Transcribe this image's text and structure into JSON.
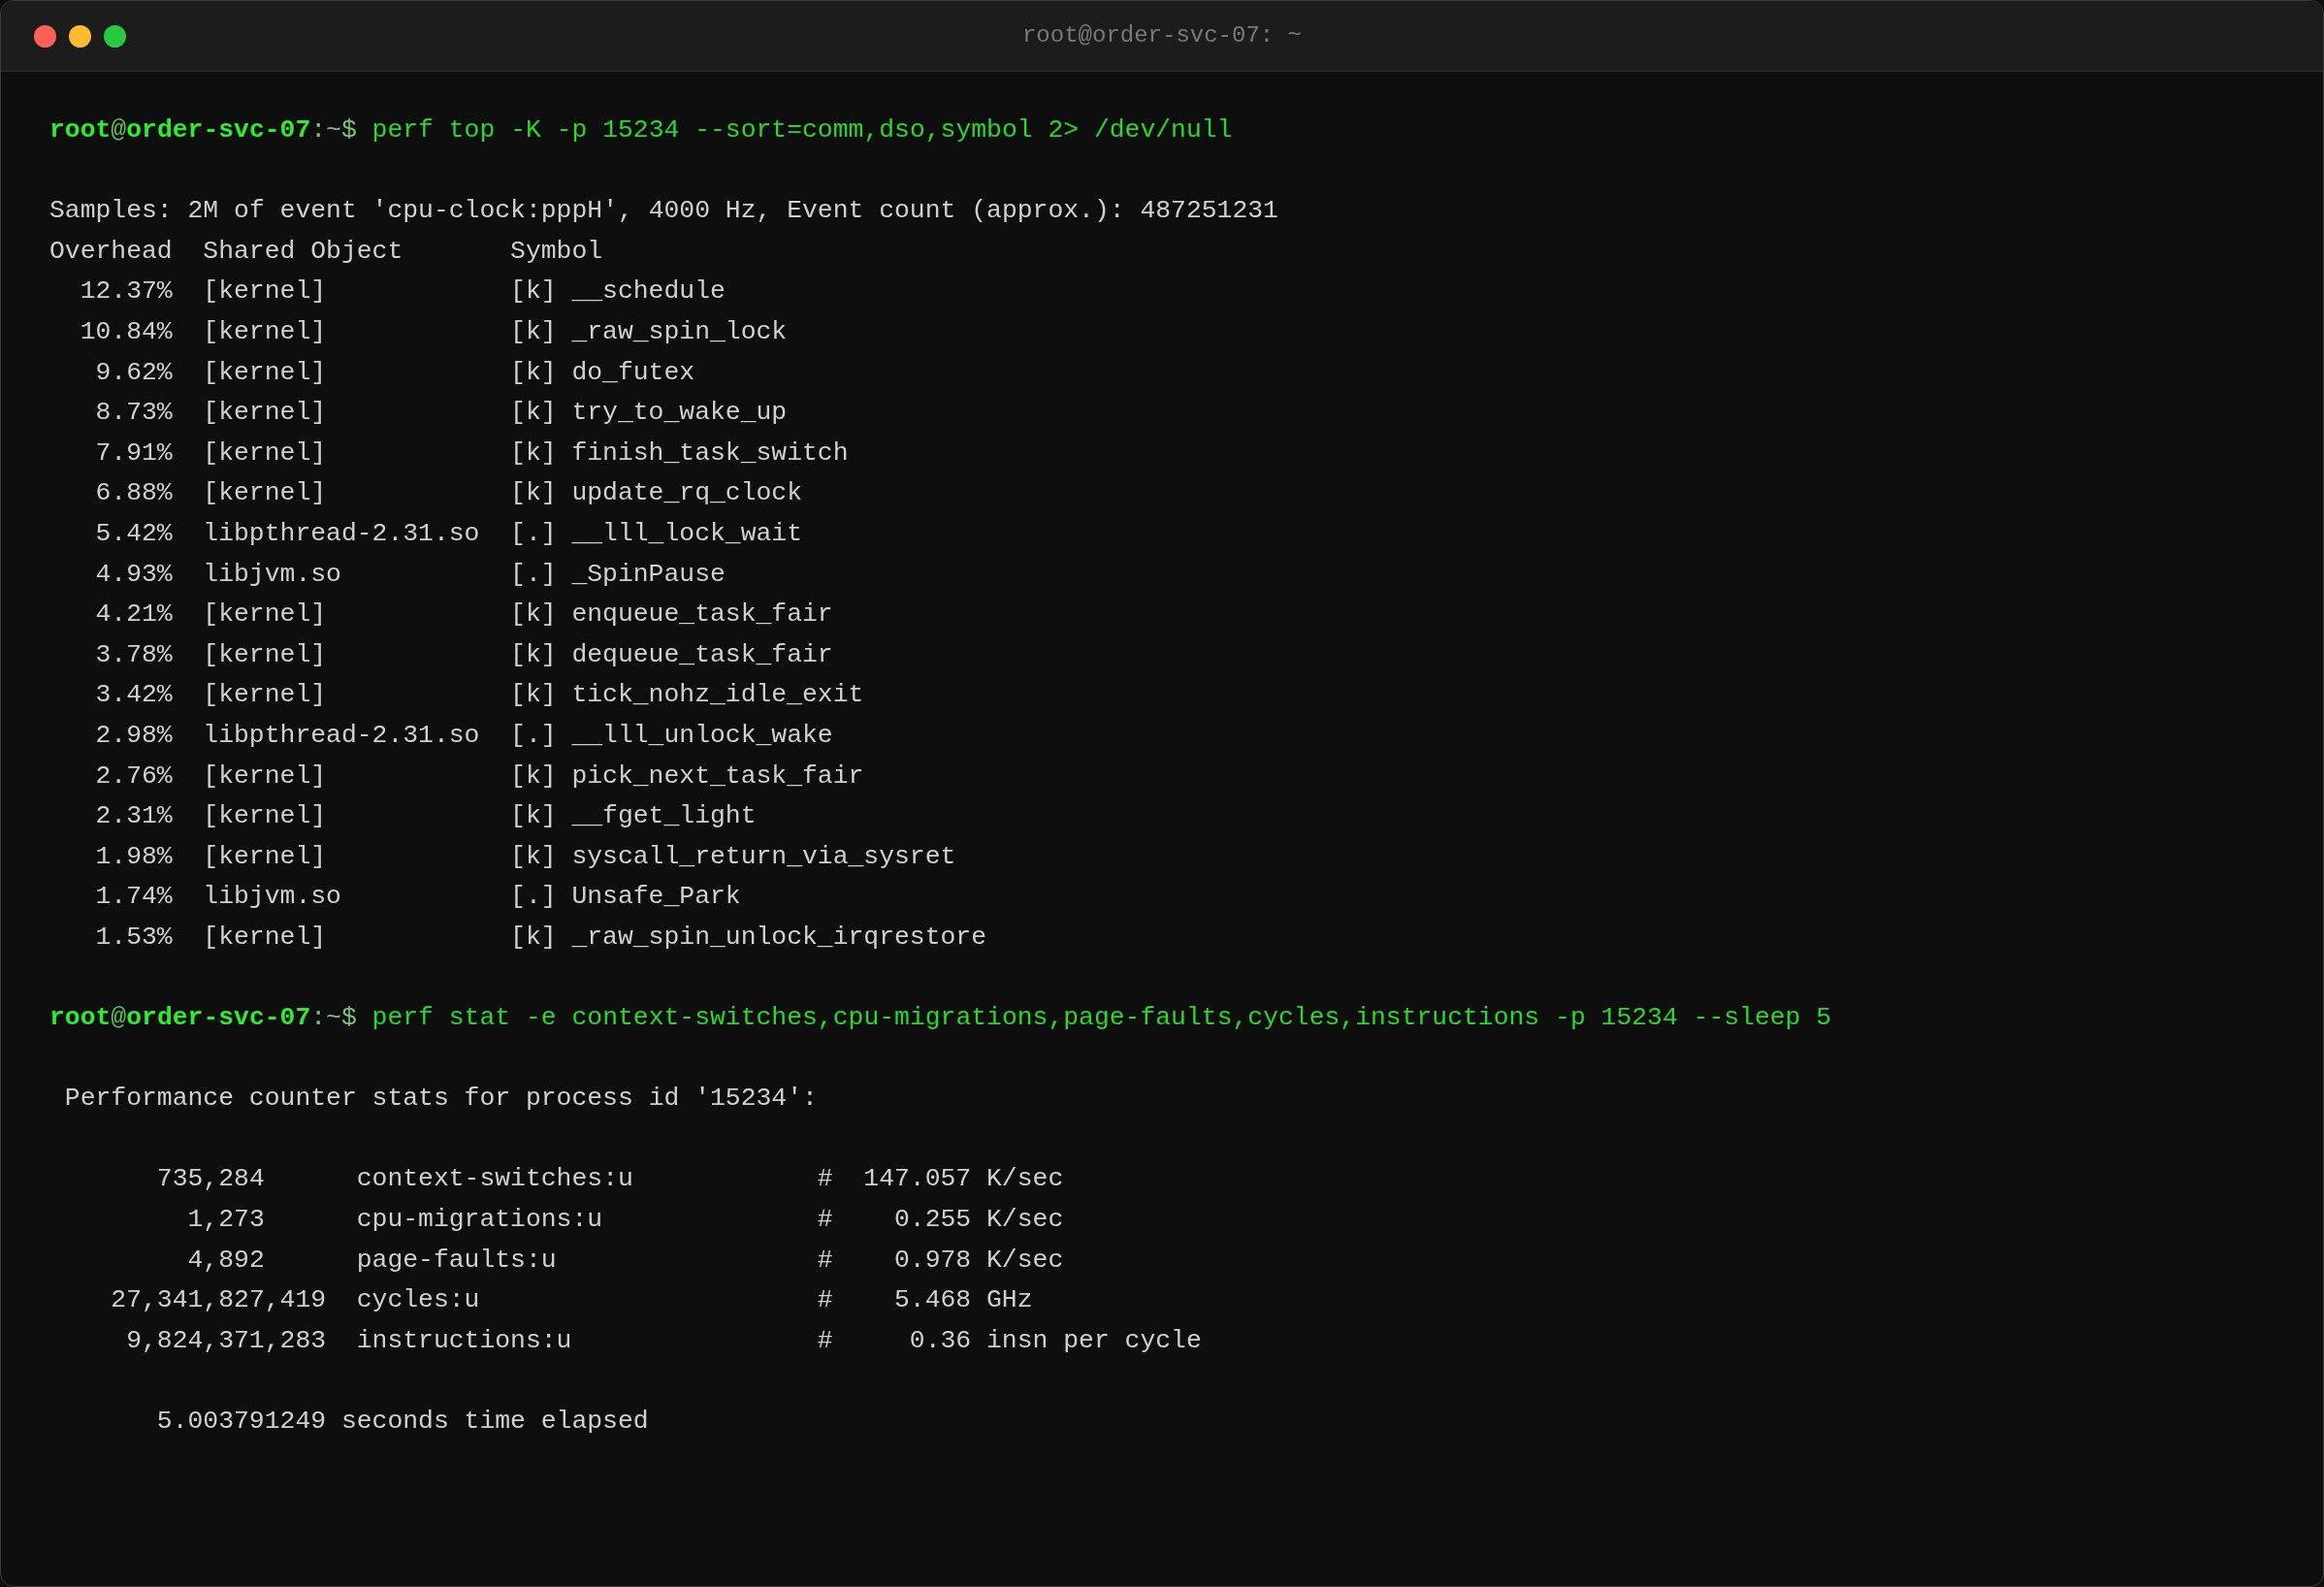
{
  "window": {
    "title": "root@order-svc-07: ~"
  },
  "lines": [
    {
      "kind": "prompt",
      "user": "root",
      "at": "@",
      "host": "order-svc-07",
      "path": ":~$",
      "command": "perf top -K -p 15234 --sort=comm,dso,symbol 2> /dev/null"
    },
    {
      "kind": "blank"
    },
    {
      "kind": "text",
      "text": "Samples: 2M of event 'cpu-clock:pppH', 4000 Hz, Event count (approx.): 487251231"
    },
    {
      "kind": "header",
      "columns": [
        "Overhead",
        "Shared Object",
        "Symbol"
      ]
    },
    {
      "kind": "perf_row",
      "overhead": "12.37%",
      "dso": "[kernel]",
      "level": "[k]",
      "symbol": "__schedule"
    },
    {
      "kind": "perf_row",
      "overhead": "10.84%",
      "dso": "[kernel]",
      "level": "[k]",
      "symbol": "_raw_spin_lock"
    },
    {
      "kind": "perf_row",
      "overhead": "9.62%",
      "dso": "[kernel]",
      "level": "[k]",
      "symbol": "do_futex"
    },
    {
      "kind": "perf_row",
      "overhead": "8.73%",
      "dso": "[kernel]",
      "level": "[k]",
      "symbol": "try_to_wake_up"
    },
    {
      "kind": "perf_row",
      "overhead": "7.91%",
      "dso": "[kernel]",
      "level": "[k]",
      "symbol": "finish_task_switch"
    },
    {
      "kind": "perf_row",
      "overhead": "6.88%",
      "dso": "[kernel]",
      "level": "[k]",
      "symbol": "update_rq_clock"
    },
    {
      "kind": "perf_row",
      "overhead": "5.42%",
      "dso": "libpthread-2.31.so",
      "level": "[.]",
      "symbol": "__lll_lock_wait"
    },
    {
      "kind": "perf_row",
      "overhead": "4.93%",
      "dso": "libjvm.so",
      "level": "[.]",
      "symbol": "_SpinPause"
    },
    {
      "kind": "perf_row",
      "overhead": "4.21%",
      "dso": "[kernel]",
      "level": "[k]",
      "symbol": "enqueue_task_fair"
    },
    {
      "kind": "perf_row",
      "overhead": "3.78%",
      "dso": "[kernel]",
      "level": "[k]",
      "symbol": "dequeue_task_fair"
    },
    {
      "kind": "perf_row",
      "overhead": "3.42%",
      "dso": "[kernel]",
      "level": "[k]",
      "symbol": "tick_nohz_idle_exit"
    },
    {
      "kind": "perf_row",
      "overhead": "2.98%",
      "dso": "libpthread-2.31.so",
      "level": "[.]",
      "symbol": "__lll_unlock_wake"
    },
    {
      "kind": "perf_row",
      "overhead": "2.76%",
      "dso": "[kernel]",
      "level": "[k]",
      "symbol": "pick_next_task_fair"
    },
    {
      "kind": "perf_row",
      "overhead": "2.31%",
      "dso": "[kernel]",
      "level": "[k]",
      "symbol": "__fget_light"
    },
    {
      "kind": "perf_row",
      "overhead": "1.98%",
      "dso": "[kernel]",
      "level": "[k]",
      "symbol": "syscall_return_via_sysret"
    },
    {
      "kind": "perf_row",
      "overhead": "1.74%",
      "dso": "libjvm.so",
      "level": "[.]",
      "symbol": "Unsafe_Park"
    },
    {
      "kind": "perf_row",
      "overhead": "1.53%",
      "dso": "[kernel]",
      "level": "[k]",
      "symbol": "_raw_spin_unlock_irqrestore"
    },
    {
      "kind": "blank"
    },
    {
      "kind": "prompt",
      "user": "root",
      "at": "@",
      "host": "order-svc-07",
      "path": ":~$",
      "command": "perf stat -e context-switches,cpu-migrations,page-faults,cycles,instructions -p 15234 --sleep 5"
    },
    {
      "kind": "blank"
    },
    {
      "kind": "indented",
      "text": "Performance counter stats for process id '15234':"
    },
    {
      "kind": "blank"
    },
    {
      "kind": "stat_row",
      "count": "735,284",
      "event": "context-switches:u",
      "hash": "#",
      "value": "147.057",
      "unit": "K/sec"
    },
    {
      "kind": "stat_row",
      "count": "1,273",
      "event": "cpu-migrations:u",
      "hash": "#",
      "value": "0.255",
      "unit": "K/sec"
    },
    {
      "kind": "stat_row",
      "count": "4,892",
      "event": "page-faults:u",
      "hash": "#",
      "value": "0.978",
      "unit": "K/sec"
    },
    {
      "kind": "stat_row",
      "count": "27,341,827,419",
      "event": "cycles:u",
      "hash": "#",
      "value": "5.468",
      "unit": "GHz"
    },
    {
      "kind": "stat_row",
      "count": "9,824,371,283",
      "event": "instructions:u",
      "hash": "#",
      "value": "0.36",
      "unit": "insn per cycle"
    },
    {
      "kind": "blank"
    },
    {
      "kind": "elapsed",
      "value": "5.003791249",
      "label": "seconds time elapsed"
    }
  ]
}
